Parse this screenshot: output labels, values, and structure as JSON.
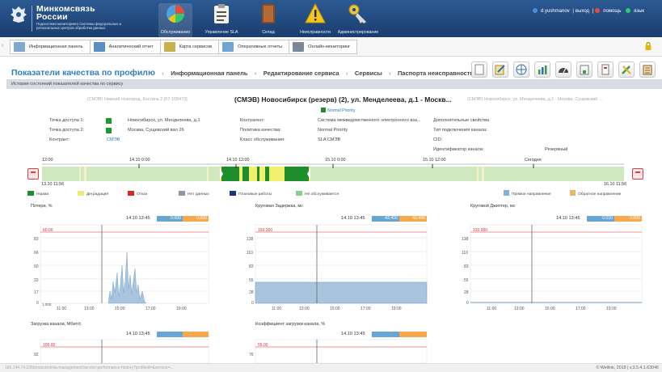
{
  "header": {
    "org_line1": "Минкомсвязь",
    "org_line2": "России",
    "org_subtitle": "Подсистема мониторинга Системы федеральных и региональных центров обработки данных",
    "nav": [
      {
        "label": "Обслуживание",
        "icon": "pie-chart-icon"
      },
      {
        "label": "Управление SLA",
        "icon": "clipboard-icon"
      },
      {
        "label": "Склад",
        "icon": "book-icon"
      },
      {
        "label": "Неисправности",
        "icon": "warning-icon"
      },
      {
        "label": "Администрирование",
        "icon": "key-icon"
      }
    ],
    "user": "d.yushmanov",
    "logout": "выход",
    "help": "помощь",
    "lang": "язык"
  },
  "tabs": [
    {
      "label": "Информационная панель"
    },
    {
      "label": "Аналитический отчет"
    },
    {
      "label": "Карта сервисов"
    },
    {
      "label": "Оперативные отчеты"
    },
    {
      "label": "Онлайн-мониторинг"
    }
  ],
  "breadcrumb": {
    "title": "Показатели качества по профилю",
    "items": [
      "Информационная панель",
      "Редактирование сервиса",
      "Сервисы",
      "Паспорта неисправности"
    ]
  },
  "toolbar": {
    "icons": [
      "page-icon",
      "edit-icon",
      "network-icon",
      "chart-icon",
      "gauge-icon",
      "table-icon",
      "report-icon",
      "tools-icon",
      "list-icon"
    ]
  },
  "section": {
    "header": "История состояний показателей качества по сервису"
  },
  "channel": {
    "prev": "(СМЭВ) Нижний Новгород, Костина 2 [57-108473]",
    "title": "(СМЭВ) Новосибирск (резерв) (2), ул. Менделеева, д.1 - Москв...",
    "next": "(СМЭВ) Новосибирск, ул. Менделеева, д.1 - Москва, Сущевский ...",
    "priority": "Normal Priority"
  },
  "info": {
    "ap1_label": "Точка доступа 1:",
    "ap1_value": "Новосибирск, ул. Менделеева, д.1",
    "ap2_label": "Точка доступа 2:",
    "ap2_value": "Москва, Сущевский вал 26",
    "contract_label": "Контракт:",
    "contract_value": "СМЭВ",
    "contractor_label": "Контрагент:",
    "contractor_value": "Система межведомственного электронного вза...",
    "policy_label": "Политика качества:",
    "policy_value": "Normal Priority",
    "class_label": "Класс обслуживания:",
    "class_value": "SLA СМЭВ",
    "extra_label": "Дополнительные свойства",
    "conn_label": "Тип подключения канала:",
    "cid_label": "CID:",
    "chid_label": "Идентификатор канала:",
    "chid_value": "Резервный"
  },
  "timeline": {
    "ticks": [
      "12:00",
      "14.10 0:00",
      "14.10 12:00",
      "15.10 0:00",
      "15.10 12:00",
      "Сегодня"
    ],
    "start": "13.10 11:56",
    "end": "16.10 11:56",
    "legend": [
      {
        "label": "Норма",
        "color": "#1f8d2c"
      },
      {
        "label": "Деградация",
        "color": "#ecec7a"
      },
      {
        "label": "Отказ",
        "color": "#d62a2a"
      },
      {
        "label": "Нет данных",
        "color": "#8a98ab"
      },
      {
        "label": "Плановые работы",
        "color": "#1b2f8f"
      },
      {
        "label": "Не обслуживается",
        "color": "#8ad08a"
      }
    ],
    "dir_forward": "Прямое направление",
    "dir_reverse": "Обратное направление"
  },
  "charts": [
    {
      "title": "Потери, %",
      "time": "14.10 13:45",
      "v1": "0.000",
      "v2": "0.000",
      "threshold": "60.00",
      "yticks": [
        "83",
        "66",
        "50",
        "33",
        "17",
        "0"
      ],
      "xticks": [
        "11:00",
        "13:00",
        "15:00",
        "17:00",
        "19:00"
      ],
      "first_label": "1.000"
    },
    {
      "title": "Круговая Задержка, мс",
      "time": "14.10 13:45",
      "v1": "43.400",
      "v2": "43.499",
      "threshold": "150.000",
      "yticks": [
        "138",
        "110",
        "83",
        "55",
        "28",
        "0"
      ],
      "xticks": [
        "11:00",
        "13:00",
        "15:00",
        "17:00",
        "19:00"
      ]
    },
    {
      "title": "Круговой Джиттер, мс",
      "time": "14.10 13:45",
      "v1": "0.016",
      "v2": "0.000",
      "threshold": "150.000",
      "yticks": [
        "138",
        "110",
        "83",
        "55",
        "28",
        "0"
      ],
      "xticks": [
        "11:00",
        "13:00",
        "15:00",
        "17:00",
        "19:00"
      ]
    },
    {
      "title": "Загрузка канала, Мбит/с",
      "time": "14.10 13:45",
      "threshold": "100.00",
      "yticks": [
        "92"
      ]
    },
    {
      "title": "Коэффициент загрузки канала, %",
      "time": "14.10 13:45",
      "threshold": "55.00",
      "yticks": [
        "76"
      ]
    }
  ],
  "footer": {
    "left": "185.144.74.226/protected/sla-management/service-performance-history?profileId=&service=...",
    "right": "© Wellink, 2018 | v.3.5.4.1.63046"
  },
  "colors": {
    "header": "#1f4a80",
    "accent": "#2f7fbf",
    "norma": "#1f8d2c",
    "degradation": "#ecec7a",
    "line": "#66a6d7"
  }
}
